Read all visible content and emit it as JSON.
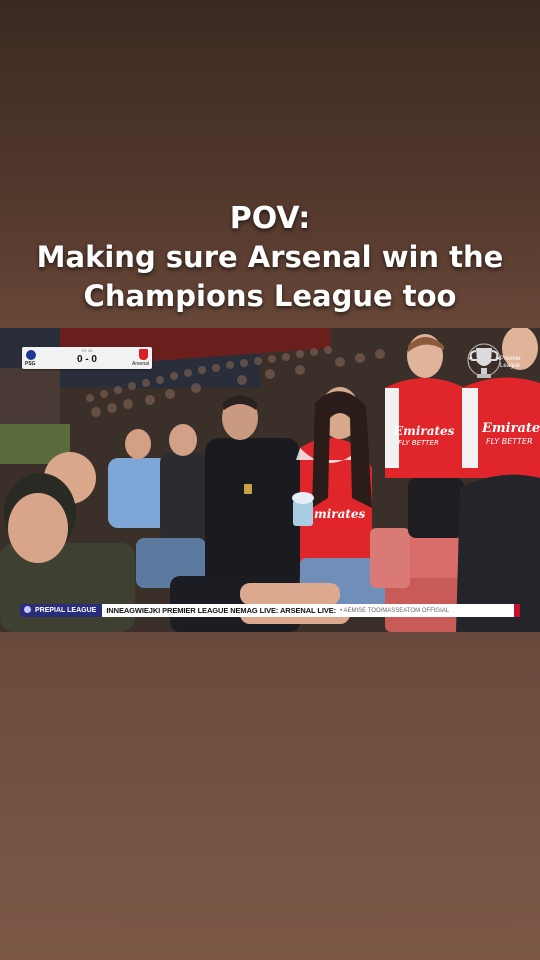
{
  "caption": {
    "line1": "POV:",
    "line2": "Making sure Arsenal win the",
    "line3": "Champions League too"
  },
  "scorebug": {
    "minute": "HT 26",
    "home_team": "PSG",
    "away_team": "Arsenal",
    "score": "0 - 0",
    "home_color": "#1b3a8c",
    "away_color": "#db1f26"
  },
  "logo": {
    "icon": "champions-league-trophy-icon",
    "text_line1": "Premier",
    "text_line2": "League"
  },
  "ticker": {
    "badge": "PREPIAL LEAGUE",
    "text": "INNEAGWIEJKI PREMIER LEAGUE NEMAG LIVE: ARSENAL LIVE:",
    "tail": "• AEMISE TOO/MASSEATOM OFFIGIAL"
  },
  "scene": {
    "shirt_sponsor": "Emirates",
    "shirt_slogan": "FLY BETTER",
    "shirt_color": "#e0262b"
  }
}
